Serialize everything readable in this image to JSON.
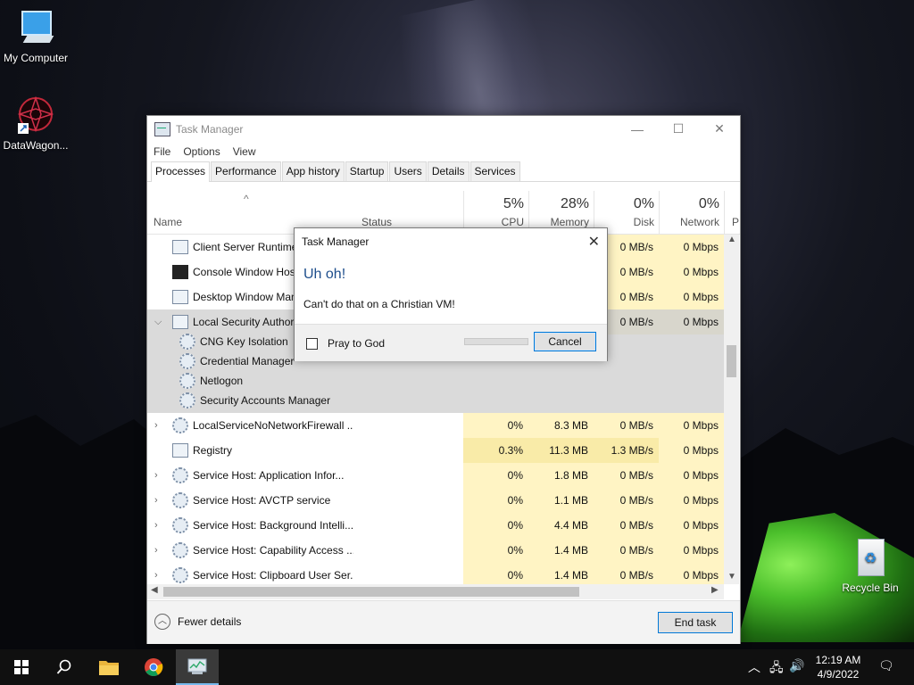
{
  "desktop": {
    "icons": [
      {
        "label": "My Computer",
        "icon": "computer-icon"
      },
      {
        "label": "DataWagon...",
        "icon": "datawagon-shortcut-icon"
      },
      {
        "label": "Recycle Bin",
        "icon": "recycle-bin-icon"
      }
    ]
  },
  "task_manager": {
    "title": "Task Manager",
    "menu": [
      "File",
      "Options",
      "View"
    ],
    "tabs": [
      "Processes",
      "Performance",
      "App history",
      "Startup",
      "Users",
      "Details",
      "Services"
    ],
    "columns": {
      "name": "Name",
      "status": "Status",
      "cpu": {
        "pct": "5%",
        "label": "CPU"
      },
      "memory": {
        "pct": "28%",
        "label": "Memory"
      },
      "disk": {
        "pct": "0%",
        "label": "Disk"
      },
      "network": {
        "pct": "0%",
        "label": "Network"
      },
      "power": "P"
    },
    "rows": [
      {
        "name": "Client Server Runtime Process",
        "cpu": "",
        "mem": "",
        "disk": "0 MB/s",
        "net": "0 Mbps"
      },
      {
        "name": "Console Window Host",
        "cpu": "",
        "mem": "",
        "disk": "0 MB/s",
        "net": "0 Mbps"
      },
      {
        "name": "Desktop Window Manager",
        "cpu": "",
        "mem": "",
        "disk": "0 MB/s",
        "net": "0 Mbps"
      },
      {
        "name": "Local Security Authority Process",
        "cpu": "",
        "mem": "",
        "disk": "0 MB/s",
        "net": "0 Mbps"
      },
      {
        "name": "CNG Key Isolation"
      },
      {
        "name": "Credential Manager"
      },
      {
        "name": "Netlogon"
      },
      {
        "name": "Security Accounts Manager"
      },
      {
        "name": "LocalServiceNoNetworkFirewall ...",
        "cpu": "0%",
        "mem": "8.3 MB",
        "disk": "0 MB/s",
        "net": "0 Mbps"
      },
      {
        "name": "Registry",
        "cpu": "0.3%",
        "mem": "11.3 MB",
        "disk": "1.3 MB/s",
        "net": "0 Mbps"
      },
      {
        "name": "Service Host: Application Infor...",
        "cpu": "0%",
        "mem": "1.8 MB",
        "disk": "0 MB/s",
        "net": "0 Mbps"
      },
      {
        "name": "Service Host: AVCTP service",
        "cpu": "0%",
        "mem": "1.1 MB",
        "disk": "0 MB/s",
        "net": "0 Mbps"
      },
      {
        "name": "Service Host: Background Intelli...",
        "cpu": "0%",
        "mem": "4.4 MB",
        "disk": "0 MB/s",
        "net": "0 Mbps"
      },
      {
        "name": "Service Host: Capability Access ...",
        "cpu": "0%",
        "mem": "1.4 MB",
        "disk": "0 MB/s",
        "net": "0 Mbps"
      },
      {
        "name": "Service Host: Clipboard User Ser...",
        "cpu": "0%",
        "mem": "1.4 MB",
        "disk": "0 MB/s",
        "net": "0 Mbps"
      }
    ],
    "footer": {
      "fewer_details": "Fewer details",
      "end_task": "End task"
    }
  },
  "dialog": {
    "title": "Task Manager",
    "heading": "Uh oh!",
    "message": "Can't do that on a Christian VM!",
    "checkbox_label": "Pray to God",
    "cancel": "Cancel"
  },
  "taskbar": {
    "time": "12:19 AM",
    "date": "4/9/2022"
  }
}
